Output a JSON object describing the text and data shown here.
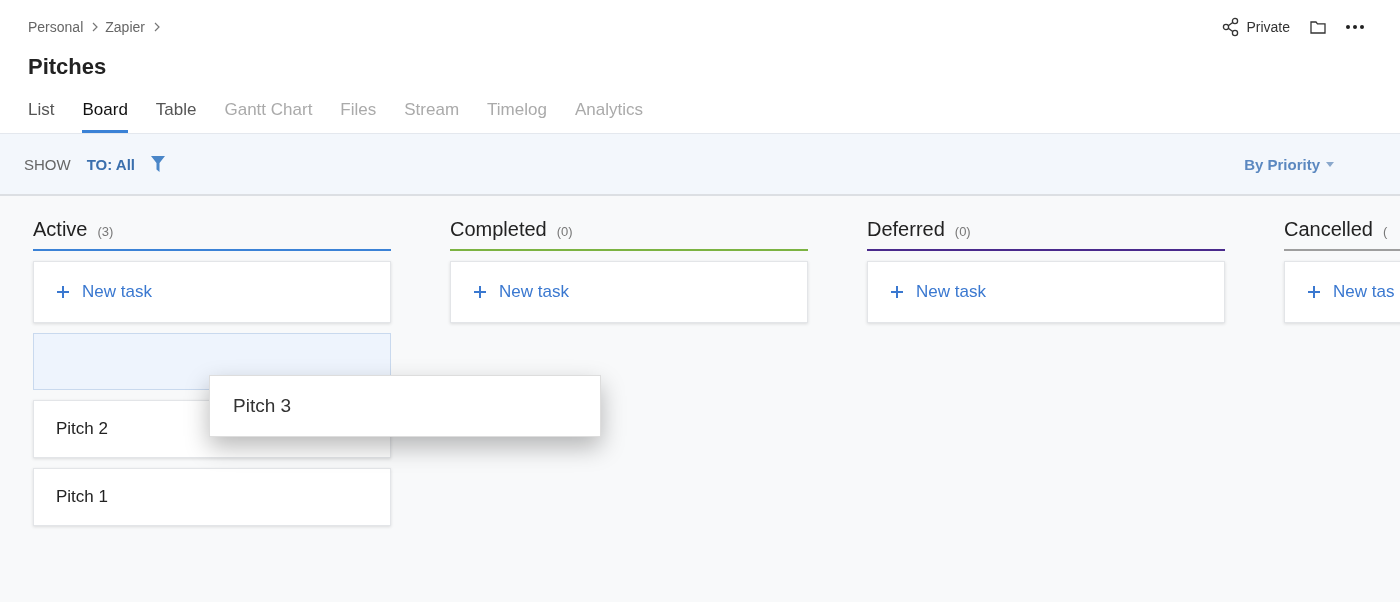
{
  "breadcrumb": [
    "Personal",
    "Zapier"
  ],
  "header_actions": {
    "share_label": "Private"
  },
  "title": "Pitches",
  "tabs": [
    {
      "label": "List",
      "selected": false,
      "disabled": false
    },
    {
      "label": "Board",
      "selected": true,
      "disabled": false
    },
    {
      "label": "Table",
      "selected": false,
      "disabled": false
    },
    {
      "label": "Gantt Chart",
      "selected": false,
      "disabled": true
    },
    {
      "label": "Files",
      "selected": false,
      "disabled": true
    },
    {
      "label": "Stream",
      "selected": false,
      "disabled": true
    },
    {
      "label": "Timelog",
      "selected": false,
      "disabled": true
    },
    {
      "label": "Analytics",
      "selected": false,
      "disabled": true
    }
  ],
  "filter_bar": {
    "show_label": "SHOW",
    "assignee_filter": "TO: All",
    "sort": "By Priority"
  },
  "columns": [
    {
      "name": "Active",
      "count": "(3)",
      "color": "#3b82d6",
      "new_task": "New task",
      "tasks": [
        {
          "kind": "placeholder"
        },
        {
          "kind": "card",
          "title": "Pitch 2"
        },
        {
          "kind": "card",
          "title": "Pitch 1"
        }
      ]
    },
    {
      "name": "Completed",
      "count": "(0)",
      "color": "#7cb342",
      "new_task": "New task"
    },
    {
      "name": "Deferred",
      "count": "(0)",
      "color": "#4a2a8c",
      "new_task": "New task"
    },
    {
      "name": "Cancelled",
      "count": "(",
      "color": "#9e9e9e",
      "new_task": "New tas"
    }
  ],
  "dragged_card": {
    "title": "Pitch 3"
  }
}
